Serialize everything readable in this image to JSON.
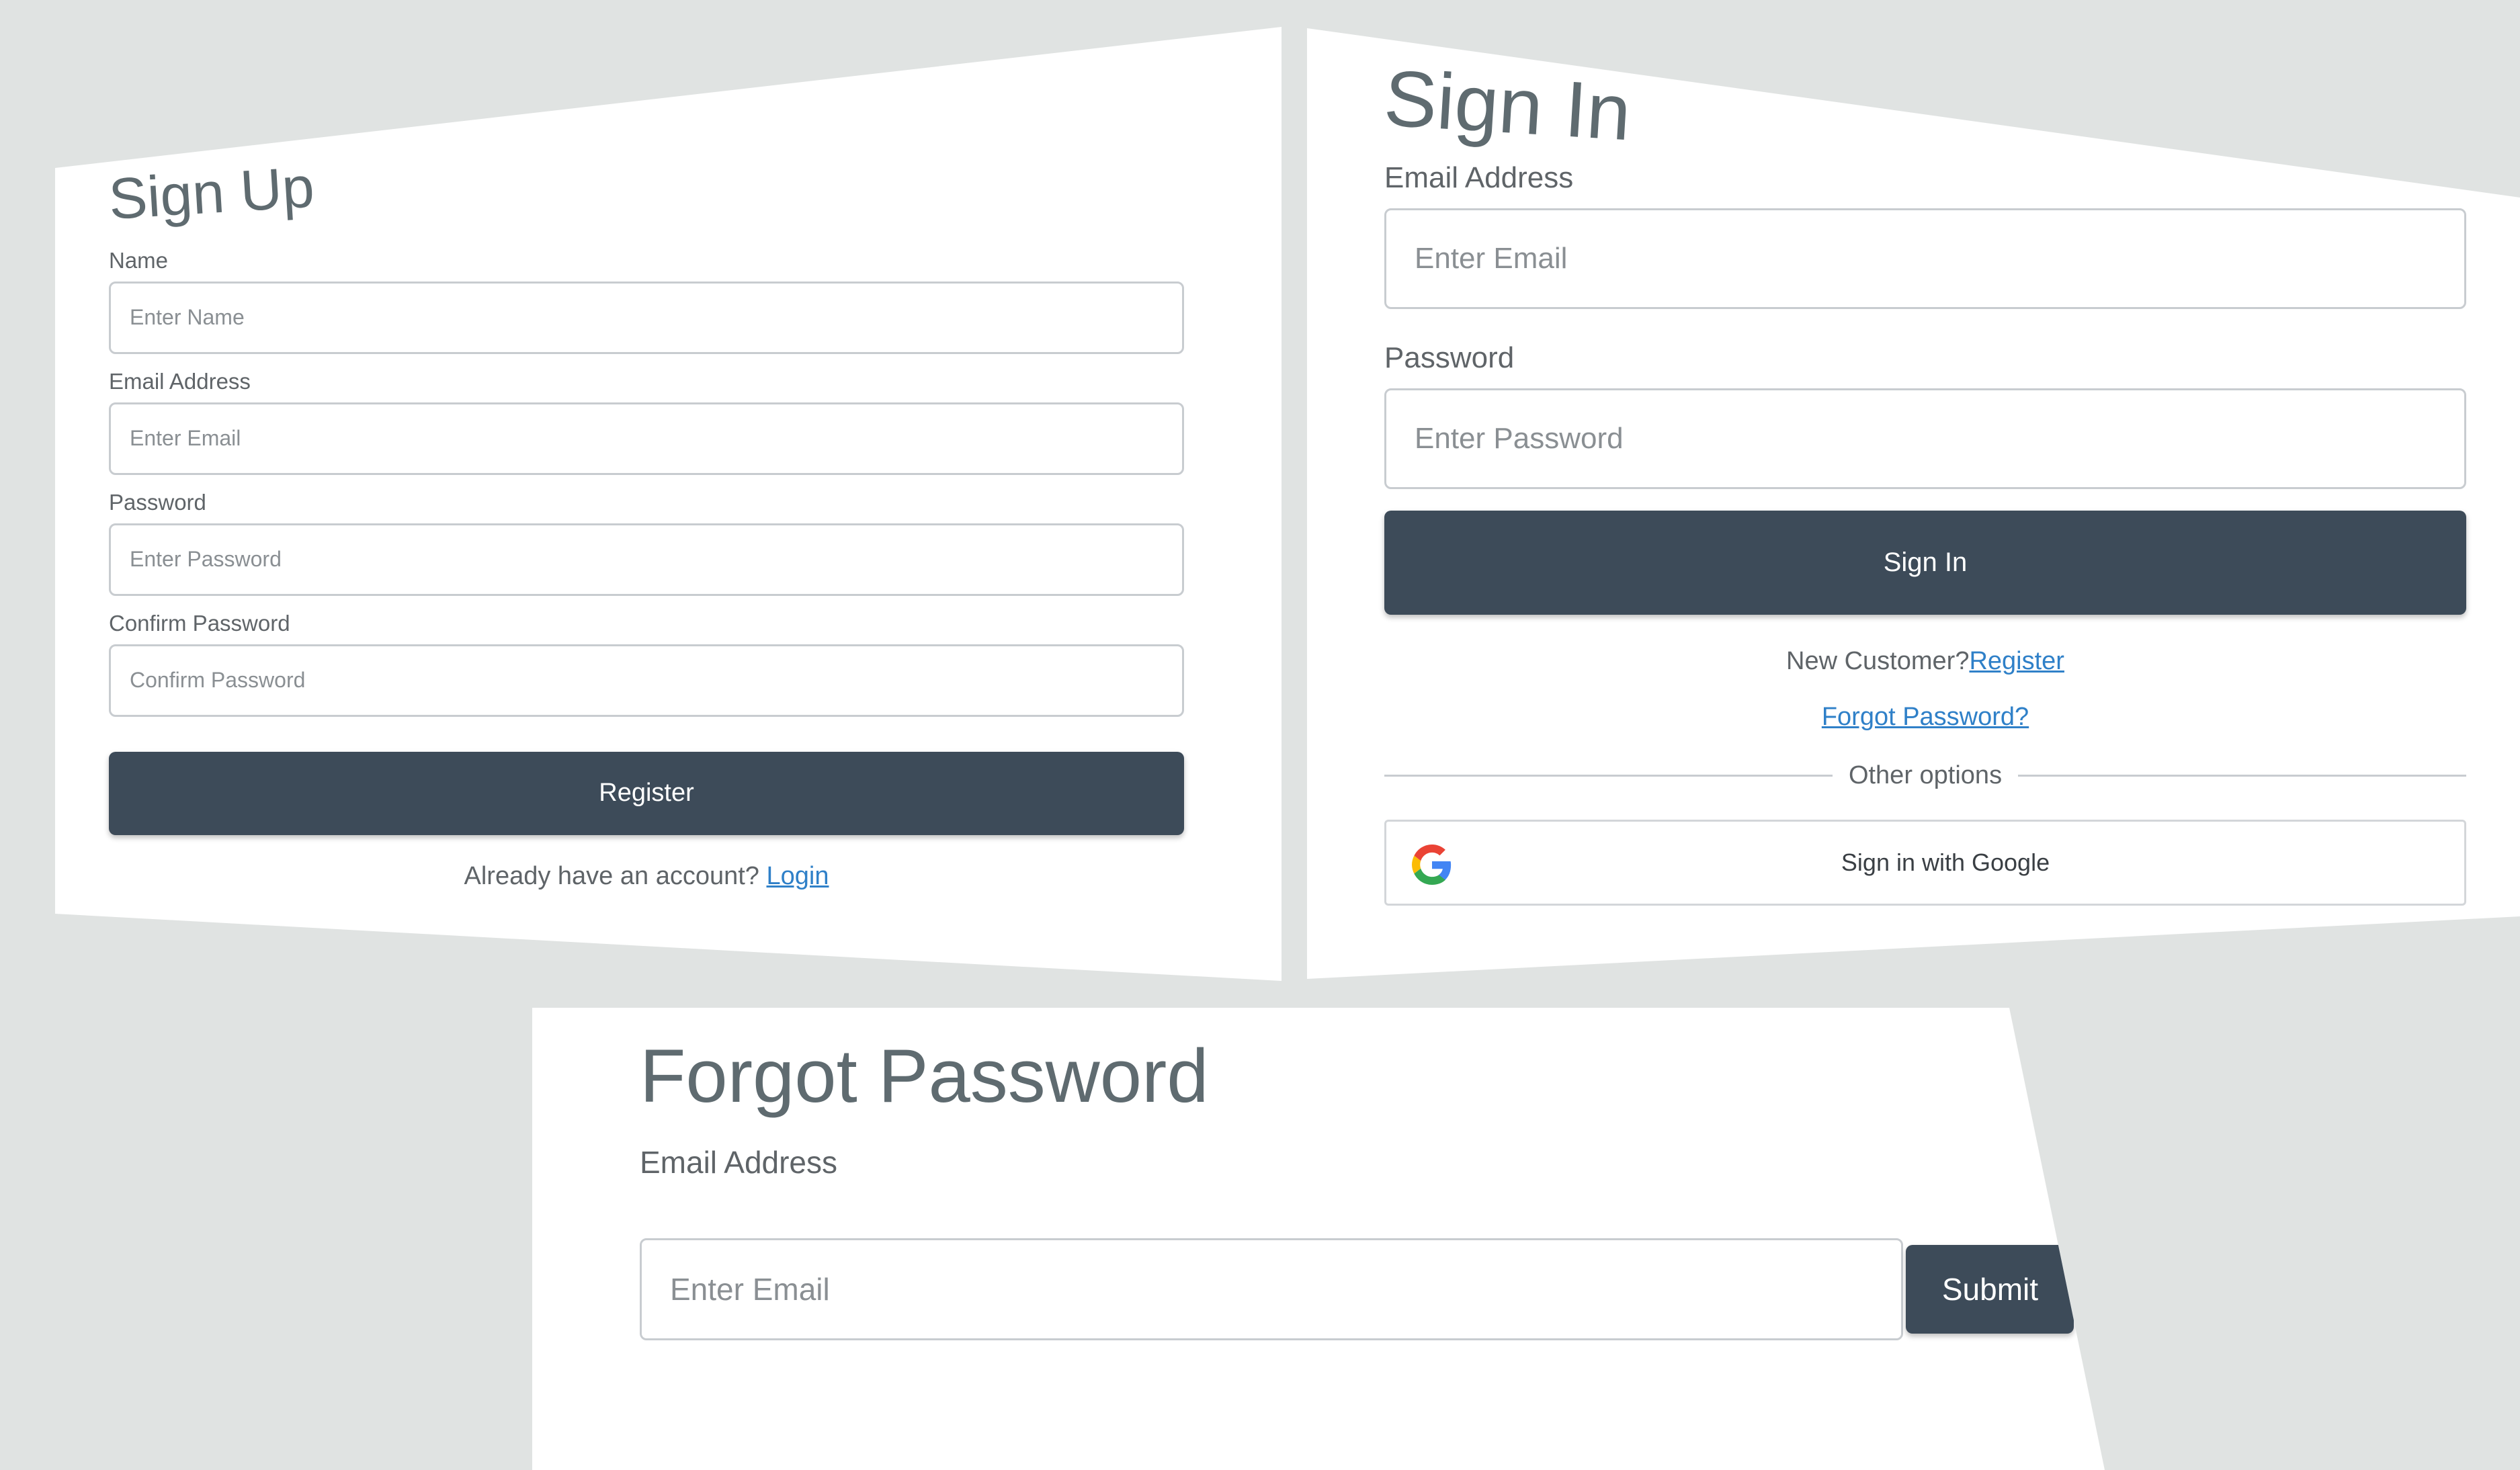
{
  "signup": {
    "title": "Sign Up",
    "name_label": "Name",
    "name_placeholder": "Enter Name",
    "email_label": "Email Address",
    "email_placeholder": "Enter Email",
    "password_label": "Password",
    "password_placeholder": "Enter Password",
    "confirm_label": "Confirm Password",
    "confirm_placeholder": "Confirm Password",
    "register_button": "Register",
    "footer_text": "Already have an account?",
    "login_link": "Login"
  },
  "signin": {
    "title": "Sign In",
    "email_label": "Email Address",
    "email_placeholder": "Enter Email",
    "password_label": "Password",
    "password_placeholder": "Enter Password",
    "signin_button": "Sign In",
    "new_customer_text": "New Customer?",
    "register_link": "Register",
    "forgot_link": "Forgot Password?",
    "divider_text": "Other options",
    "google_button": "Sign in with Google",
    "google_icon": "google-g-icon"
  },
  "forgot": {
    "title": "Forgot Password",
    "email_label": "Email Address",
    "email_placeholder": "Enter Email",
    "submit_button": "Submit"
  },
  "colors": {
    "background": "#e0e3e2",
    "button": "#3d4b59",
    "link": "#2f80c8",
    "title": "#5f6b70"
  }
}
